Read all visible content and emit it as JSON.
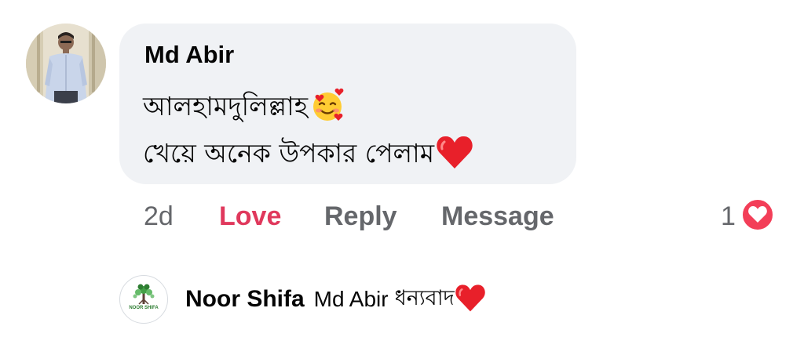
{
  "comment": {
    "author": "Md Abir",
    "line1": "আলহামদুলিল্লাহ",
    "line2": "খেয়ে অনেক উপকার পেলাম",
    "line1_emoji": "smiling-face-with-hearts-icon",
    "line2_emoji": "red-heart-icon",
    "time": "2d",
    "actions": {
      "love": "Love",
      "reply": "Reply",
      "message": "Message"
    },
    "reaction_count": "1",
    "reaction_icon": "love-reaction-icon"
  },
  "reply": {
    "author": "Noor Shifa",
    "mention": "Md Abir",
    "text": "ধন্যবাদ",
    "emoji": "red-heart-icon",
    "logo_text": "NOOR SHIFA"
  },
  "colors": {
    "bubble": "#f0f2f5",
    "love": "#e0385c",
    "secondary_text": "#65676b",
    "heart": "#e8202a"
  }
}
